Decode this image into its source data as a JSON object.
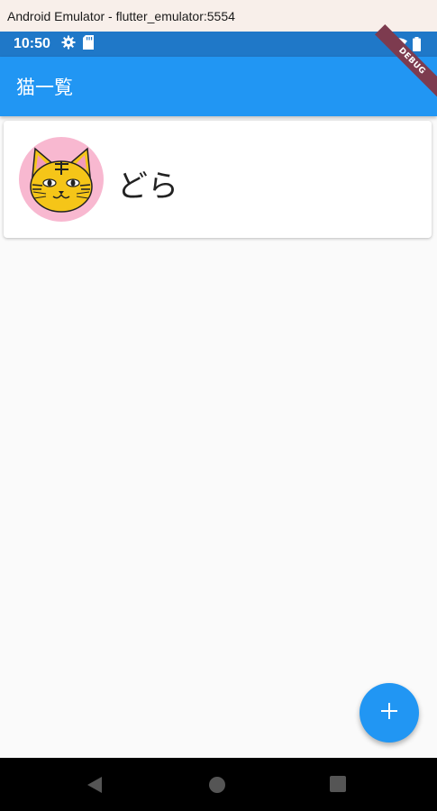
{
  "window": {
    "title": "Android Emulator - flutter_emulator:5554"
  },
  "status_bar": {
    "time": "10:50",
    "left_icons": [
      "gear-icon",
      "sd-card-icon"
    ],
    "right_icons": [
      "wifi-icon",
      "battery-icon"
    ],
    "color": "#1f78c8"
  },
  "app_bar": {
    "title": "猫一覧",
    "color": "#2196f3"
  },
  "debug_banner": {
    "label": "DEBUG",
    "color": "#7d3b4f"
  },
  "cats": [
    {
      "name": "どら",
      "avatar_icon": "tiger-cat-icon",
      "avatar_bg": "#f8b8d0"
    }
  ],
  "fab": {
    "label": "+",
    "icon": "plus-icon"
  },
  "nav_bar": {
    "buttons": [
      "back-icon",
      "home-icon",
      "recents-icon"
    ]
  }
}
